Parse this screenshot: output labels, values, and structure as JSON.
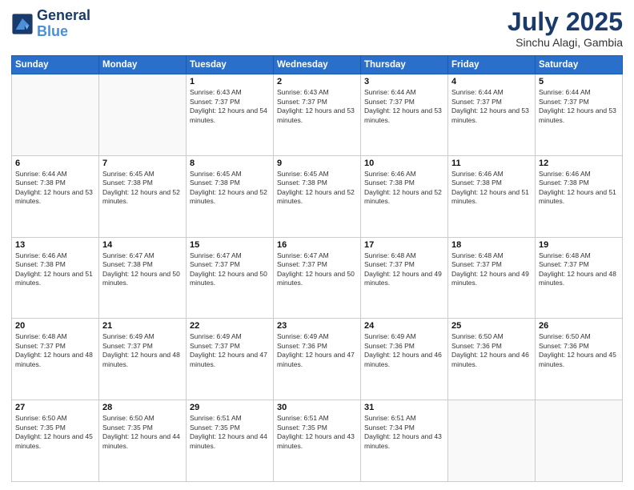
{
  "header": {
    "logo_line1": "General",
    "logo_line2": "Blue",
    "month": "July 2025",
    "location": "Sinchu Alagi, Gambia"
  },
  "days_of_week": [
    "Sunday",
    "Monday",
    "Tuesday",
    "Wednesday",
    "Thursday",
    "Friday",
    "Saturday"
  ],
  "weeks": [
    [
      {
        "day": "",
        "info": ""
      },
      {
        "day": "",
        "info": ""
      },
      {
        "day": "1",
        "info": "Sunrise: 6:43 AM\nSunset: 7:37 PM\nDaylight: 12 hours and 54 minutes."
      },
      {
        "day": "2",
        "info": "Sunrise: 6:43 AM\nSunset: 7:37 PM\nDaylight: 12 hours and 53 minutes."
      },
      {
        "day": "3",
        "info": "Sunrise: 6:44 AM\nSunset: 7:37 PM\nDaylight: 12 hours and 53 minutes."
      },
      {
        "day": "4",
        "info": "Sunrise: 6:44 AM\nSunset: 7:37 PM\nDaylight: 12 hours and 53 minutes."
      },
      {
        "day": "5",
        "info": "Sunrise: 6:44 AM\nSunset: 7:37 PM\nDaylight: 12 hours and 53 minutes."
      }
    ],
    [
      {
        "day": "6",
        "info": "Sunrise: 6:44 AM\nSunset: 7:38 PM\nDaylight: 12 hours and 53 minutes."
      },
      {
        "day": "7",
        "info": "Sunrise: 6:45 AM\nSunset: 7:38 PM\nDaylight: 12 hours and 52 minutes."
      },
      {
        "day": "8",
        "info": "Sunrise: 6:45 AM\nSunset: 7:38 PM\nDaylight: 12 hours and 52 minutes."
      },
      {
        "day": "9",
        "info": "Sunrise: 6:45 AM\nSunset: 7:38 PM\nDaylight: 12 hours and 52 minutes."
      },
      {
        "day": "10",
        "info": "Sunrise: 6:46 AM\nSunset: 7:38 PM\nDaylight: 12 hours and 52 minutes."
      },
      {
        "day": "11",
        "info": "Sunrise: 6:46 AM\nSunset: 7:38 PM\nDaylight: 12 hours and 51 minutes."
      },
      {
        "day": "12",
        "info": "Sunrise: 6:46 AM\nSunset: 7:38 PM\nDaylight: 12 hours and 51 minutes."
      }
    ],
    [
      {
        "day": "13",
        "info": "Sunrise: 6:46 AM\nSunset: 7:38 PM\nDaylight: 12 hours and 51 minutes."
      },
      {
        "day": "14",
        "info": "Sunrise: 6:47 AM\nSunset: 7:38 PM\nDaylight: 12 hours and 50 minutes."
      },
      {
        "day": "15",
        "info": "Sunrise: 6:47 AM\nSunset: 7:37 PM\nDaylight: 12 hours and 50 minutes."
      },
      {
        "day": "16",
        "info": "Sunrise: 6:47 AM\nSunset: 7:37 PM\nDaylight: 12 hours and 50 minutes."
      },
      {
        "day": "17",
        "info": "Sunrise: 6:48 AM\nSunset: 7:37 PM\nDaylight: 12 hours and 49 minutes."
      },
      {
        "day": "18",
        "info": "Sunrise: 6:48 AM\nSunset: 7:37 PM\nDaylight: 12 hours and 49 minutes."
      },
      {
        "day": "19",
        "info": "Sunrise: 6:48 AM\nSunset: 7:37 PM\nDaylight: 12 hours and 48 minutes."
      }
    ],
    [
      {
        "day": "20",
        "info": "Sunrise: 6:48 AM\nSunset: 7:37 PM\nDaylight: 12 hours and 48 minutes."
      },
      {
        "day": "21",
        "info": "Sunrise: 6:49 AM\nSunset: 7:37 PM\nDaylight: 12 hours and 48 minutes."
      },
      {
        "day": "22",
        "info": "Sunrise: 6:49 AM\nSunset: 7:37 PM\nDaylight: 12 hours and 47 minutes."
      },
      {
        "day": "23",
        "info": "Sunrise: 6:49 AM\nSunset: 7:36 PM\nDaylight: 12 hours and 47 minutes."
      },
      {
        "day": "24",
        "info": "Sunrise: 6:49 AM\nSunset: 7:36 PM\nDaylight: 12 hours and 46 minutes."
      },
      {
        "day": "25",
        "info": "Sunrise: 6:50 AM\nSunset: 7:36 PM\nDaylight: 12 hours and 46 minutes."
      },
      {
        "day": "26",
        "info": "Sunrise: 6:50 AM\nSunset: 7:36 PM\nDaylight: 12 hours and 45 minutes."
      }
    ],
    [
      {
        "day": "27",
        "info": "Sunrise: 6:50 AM\nSunset: 7:35 PM\nDaylight: 12 hours and 45 minutes."
      },
      {
        "day": "28",
        "info": "Sunrise: 6:50 AM\nSunset: 7:35 PM\nDaylight: 12 hours and 44 minutes."
      },
      {
        "day": "29",
        "info": "Sunrise: 6:51 AM\nSunset: 7:35 PM\nDaylight: 12 hours and 44 minutes."
      },
      {
        "day": "30",
        "info": "Sunrise: 6:51 AM\nSunset: 7:35 PM\nDaylight: 12 hours and 43 minutes."
      },
      {
        "day": "31",
        "info": "Sunrise: 6:51 AM\nSunset: 7:34 PM\nDaylight: 12 hours and 43 minutes."
      },
      {
        "day": "",
        "info": ""
      },
      {
        "day": "",
        "info": ""
      }
    ]
  ]
}
